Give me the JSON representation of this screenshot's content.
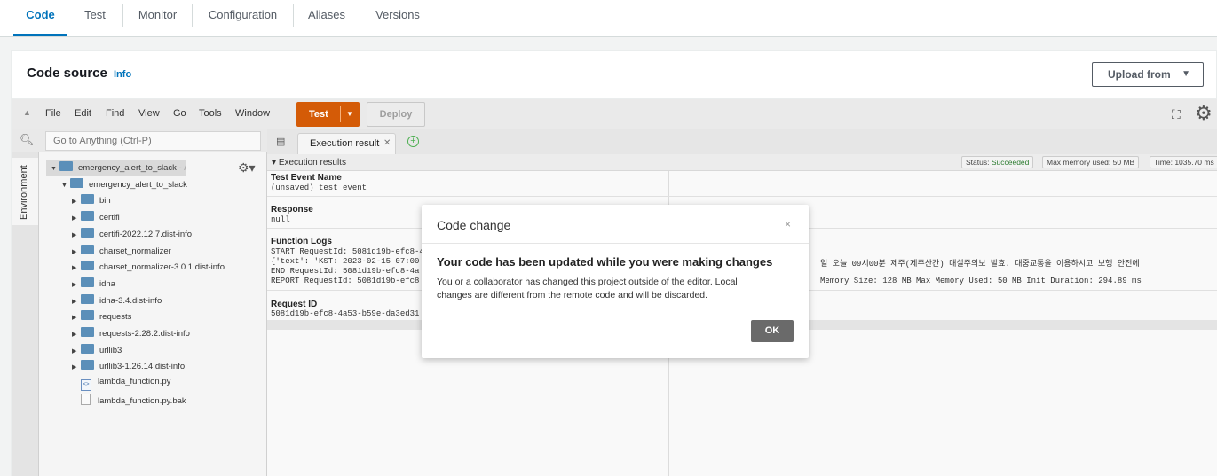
{
  "tabs": [
    {
      "label": "Code",
      "active": true
    },
    {
      "label": "Test"
    },
    {
      "label": "Monitor"
    },
    {
      "label": "Configuration"
    },
    {
      "label": "Aliases"
    },
    {
      "label": "Versions"
    }
  ],
  "code_source": {
    "title": "Code source",
    "info_label": "Info",
    "upload_label": "Upload from"
  },
  "ide": {
    "menu": [
      "File",
      "Edit",
      "Find",
      "View",
      "Go",
      "Tools",
      "Window"
    ],
    "test_label": "Test",
    "deploy_label": "Deploy",
    "search_placeholder": "Go to Anything (Ctrl-P)",
    "environment_label": "Environment",
    "tree": [
      {
        "label": "emergency_alert_to_slack",
        "suffix": " - /",
        "type": "folder",
        "depth": 0,
        "open": true
      },
      {
        "label": "emergency_alert_to_slack",
        "type": "folder",
        "depth": 1,
        "open": true
      },
      {
        "label": "bin",
        "type": "folder",
        "depth": 2
      },
      {
        "label": "certifi",
        "type": "folder",
        "depth": 2
      },
      {
        "label": "certifi-2022.12.7.dist-info",
        "type": "folder",
        "depth": 2
      },
      {
        "label": "charset_normalizer",
        "type": "folder",
        "depth": 2
      },
      {
        "label": "charset_normalizer-3.0.1.dist-info",
        "type": "folder",
        "depth": 2
      },
      {
        "label": "idna",
        "type": "folder",
        "depth": 2
      },
      {
        "label": "idna-3.4.dist-info",
        "type": "folder",
        "depth": 2
      },
      {
        "label": "requests",
        "type": "folder",
        "depth": 2
      },
      {
        "label": "requests-2.28.2.dist-info",
        "type": "folder",
        "depth": 2
      },
      {
        "label": "urllib3",
        "type": "folder",
        "depth": 2
      },
      {
        "label": "urllib3-1.26.14.dist-info",
        "type": "folder",
        "depth": 2
      },
      {
        "label": "lambda_function.py",
        "type": "py",
        "depth": 2
      },
      {
        "label": "lambda_function.py.bak",
        "type": "bak",
        "depth": 2
      }
    ],
    "editor_tab_label": "Execution result",
    "results": {
      "header": "Execution results",
      "status_label": "Status:",
      "status_value": "Succeeded",
      "memory_label": "Max memory used:",
      "memory_value": "50 MB",
      "time_label": "Time:",
      "time_value": "1035.70 ms",
      "test_event_label": "Test Event Name",
      "test_event_value": "(unsaved) test event",
      "response_label": "Response",
      "response_value": "null",
      "logs_label": "Function Logs",
      "log_start": "START RequestId: 5081d19b-efc8-4",
      "log_text": "{'text': 'KST: 2023-02-15 07:00",
      "log_end": "END RequestId: 5081d19b-efc8-4a",
      "log_report": "REPORT RequestId: 5081d19b-efc8",
      "log_text_right": "일 오늘 09시00분 제주(제주산간) 대설주의보 발효. 대중교통을 이용하시고 보행 안전에",
      "log_report_right": "Memory Size: 128 MB Max Memory Used: 50 MB  Init Duration: 294.89 ms",
      "request_id_label": "Request ID",
      "request_id_value": "5081d19b-efc8-4a53-b59e-da3ed31"
    }
  },
  "modal": {
    "title": "Code change",
    "close": "×",
    "heading": "Your code has been updated while you were making changes",
    "body": "You or a collaborator has changed this project outside of the editor. Local changes are different from the remote code and will be discarded.",
    "ok_label": "OK"
  }
}
